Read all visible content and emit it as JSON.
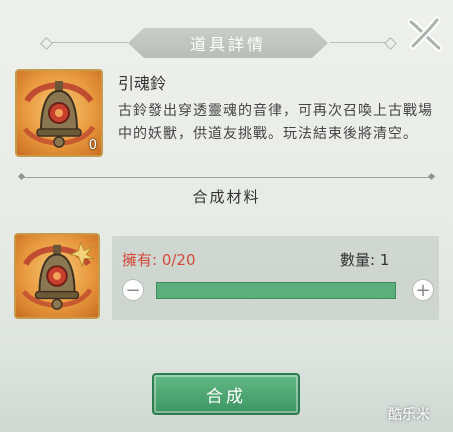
{
  "dialog": {
    "title": "道具詳情",
    "close_icon": "close-brush-icon"
  },
  "item": {
    "name": "引魂鈴",
    "count": "0",
    "icon": "bell-icon",
    "description": "古鈴發出穿透靈魂的音律，可再次召喚上古戰場中的妖獸，供道友挑戰。玩法結束後將清空。"
  },
  "materials": {
    "section_title": "合成材料",
    "owned_label": "擁有: 0/20",
    "quantity_label": "數量: 1",
    "quantity_level": 1,
    "minus_symbol": "−",
    "plus_symbol": "+",
    "material_icon": "bell-icon",
    "accent_color": "#5cae7c",
    "owned_color": "#d14a3c"
  },
  "actions": {
    "synthesize_label": "合成"
  },
  "watermark": "酷乐米"
}
